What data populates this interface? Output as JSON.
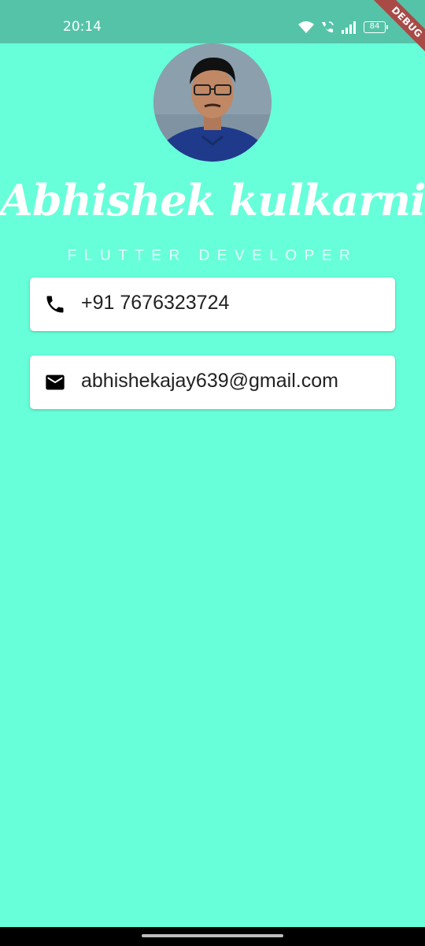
{
  "status_bar": {
    "time": "20:14",
    "battery": "84",
    "icons": [
      "wifi-icon",
      "wifi-call-icon",
      "signal-icon",
      "battery-icon"
    ]
  },
  "debug_banner": "DEBUG",
  "profile": {
    "name": "Abhishek kulkarni",
    "title": "FLUTTER DEVELOPER"
  },
  "contacts": {
    "phone": {
      "icon": "phone-icon",
      "text": "+91 7676323724"
    },
    "email": {
      "icon": "mail-icon",
      "text": "abhishekajay639@gmail.com"
    }
  },
  "colors": {
    "background": "#66ffd9",
    "status_bar": "#55c3a8",
    "card": "#ffffff",
    "debug_ribbon": "#a94a46"
  }
}
